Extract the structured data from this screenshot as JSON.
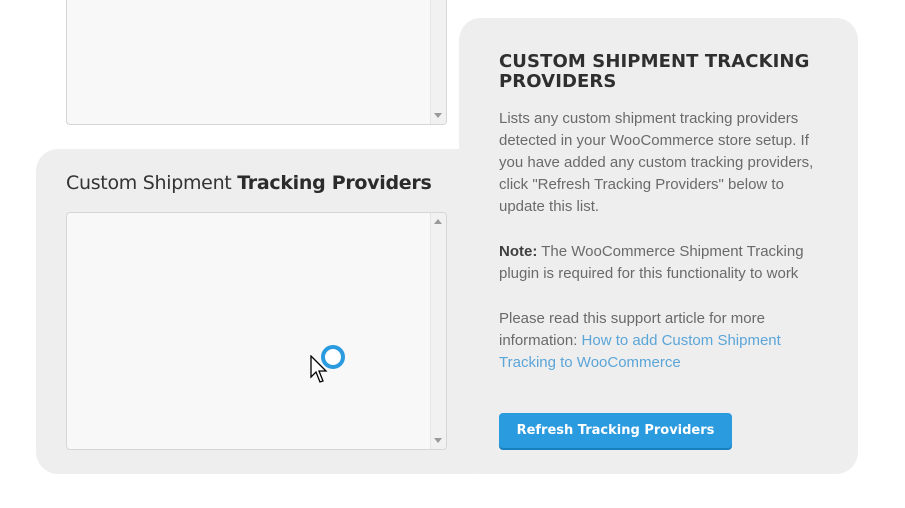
{
  "section": {
    "title_prefix": "Custom Shipment",
    "title_bold": "Tracking Providers"
  },
  "info": {
    "heading": "CUSTOM SHIPMENT TRACKING PROVIDERS",
    "description": "Lists any custom shipment tracking providers detected in your WooCommerce store setup. If you have added any custom tracking providers, click \"Refresh Tracking Providers\" below to update this list.",
    "note_label": "Note:",
    "note_text": "The WooCommerce Shipment Tracking plugin is required for this functionality to work",
    "support_text": "Please read this support article for more information:",
    "support_link": "How to add Custom Shipment Tracking to WooCommerce"
  },
  "actions": {
    "refresh_label": "Refresh Tracking Providers"
  },
  "colors": {
    "accent": "#2b9be0",
    "link": "#5ba5d9",
    "panel": "#eeeeee"
  }
}
